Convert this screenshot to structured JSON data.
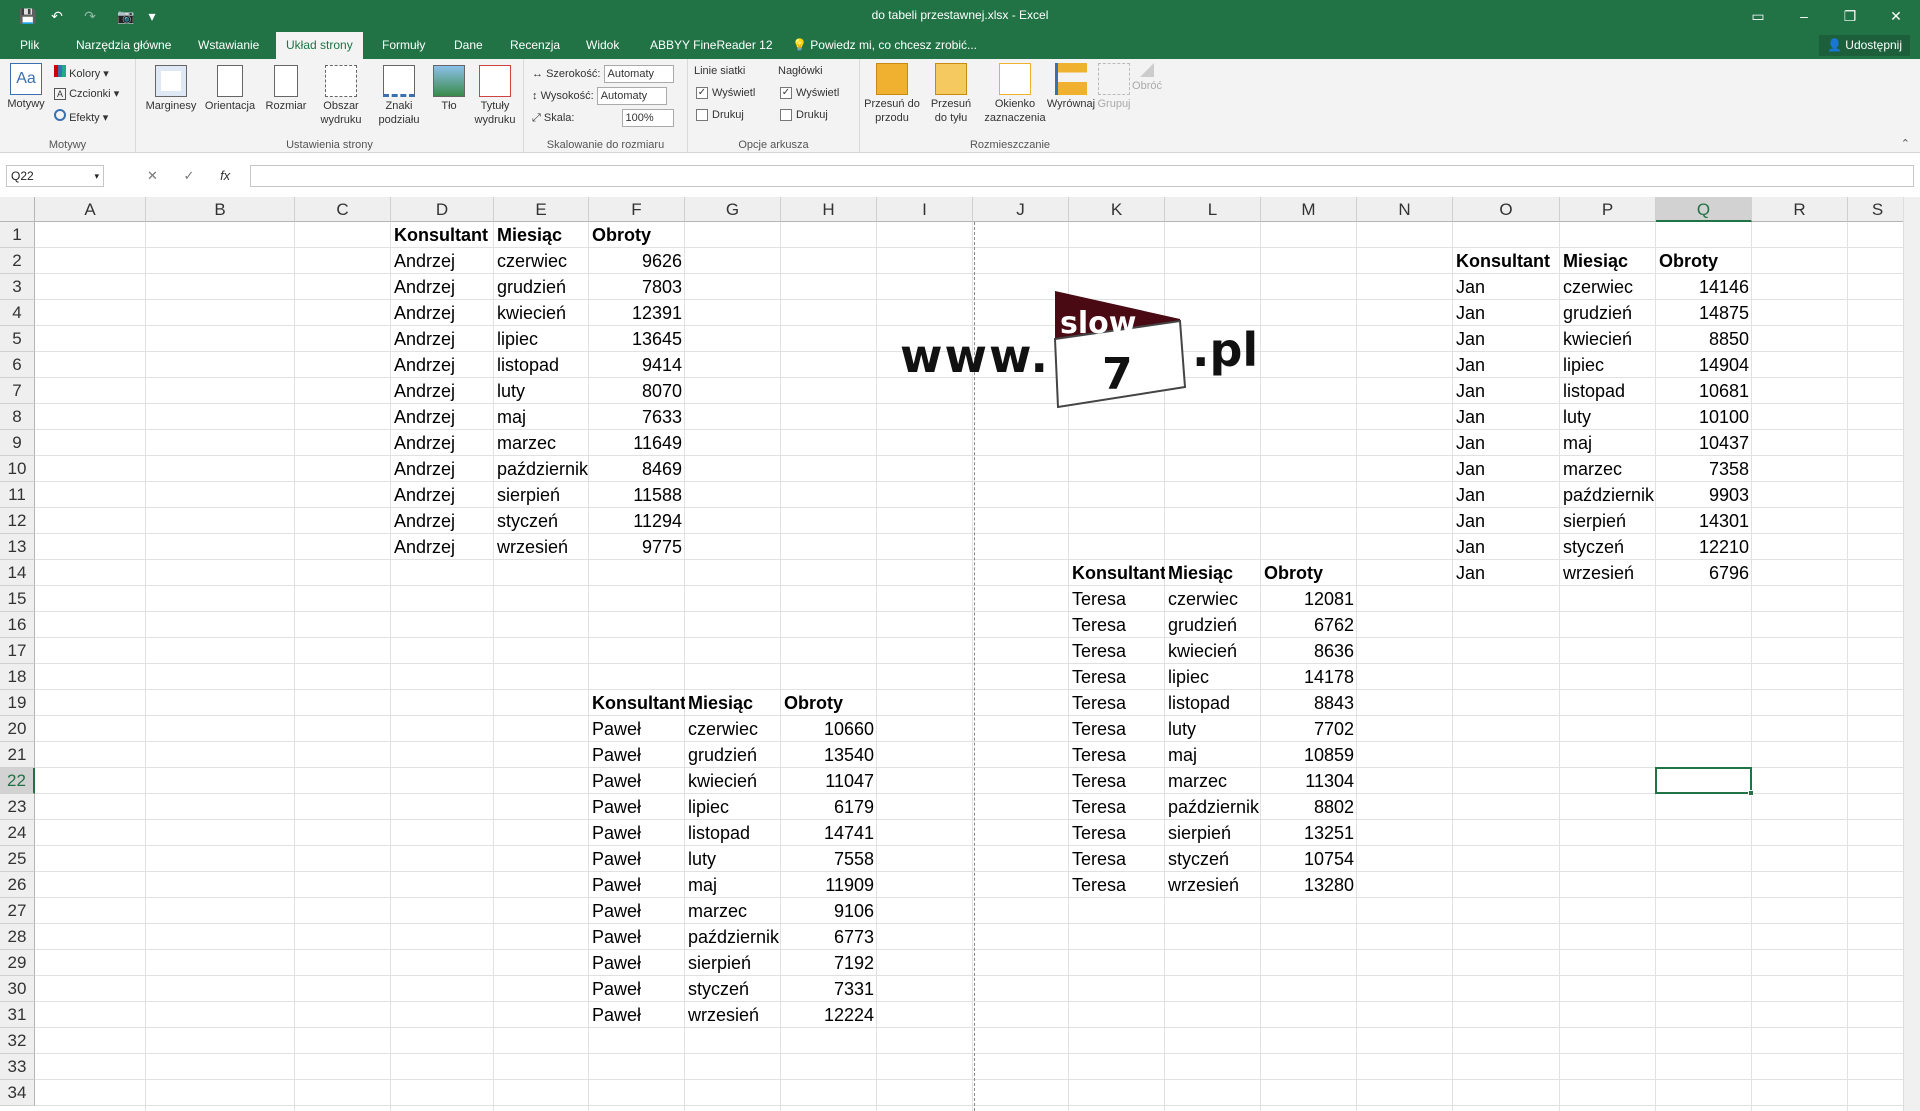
{
  "titlebar": {
    "title": "do tabeli przestawnej.xlsx - Excel"
  },
  "tabs": [
    "Plik",
    "Narzędzia główne",
    "Wstawianie",
    "Układ strony",
    "Formuły",
    "Dane",
    "Recenzja",
    "Widok",
    "ABBYY FineReader 12",
    "Powiedz mi, co chcesz zrobić..."
  ],
  "share_label": "Udostępnij",
  "ribbon": {
    "motywy": {
      "btn": "Motywy",
      "kolory": "Kolory",
      "czcionki": "Czcionki",
      "efekty": "Efekty",
      "label": "Motywy"
    },
    "ustawienia": {
      "marginesy": "Marginesy",
      "orientacja": "Orientacja",
      "rozmiar": "Rozmiar",
      "obszar1": "Obszar",
      "obszar2": "wydruku",
      "znaki1": "Znaki",
      "znaki2": "podziału",
      "tlo": "Tło",
      "tytuly1": "Tytuły",
      "tytuly2": "wydruku",
      "label": "Ustawienia strony"
    },
    "skalowanie": {
      "szerokosc": "Szerokość:",
      "wysokosc": "Wysokość:",
      "skala": "Skala:",
      "auto1": "Automaty",
      "auto2": "Automaty",
      "scale_value": "100%",
      "label": "Skalowanie do rozmiaru"
    },
    "opcje": {
      "linie": "Linie siatki",
      "naglowki": "Nagłówki",
      "wyswietl1": "Wyświetl",
      "drukuj1": "Drukuj",
      "wyswietl2": "Wyświetl",
      "drukuj2": "Drukuj",
      "label": "Opcje arkusza"
    },
    "rozmieszczanie": {
      "przesun_przod1": "Przesuń do",
      "przesun_przod2": "przodu",
      "przesun_tyl1": "Przesuń",
      "przesun_tyl2": "do tyłu",
      "okienko1": "Okienko",
      "okienko2": "zaznaczenia",
      "wyrownaj": "Wyrównaj",
      "grupuj": "Grupuj",
      "obroc": "Obróć",
      "label": "Rozmieszczanie"
    }
  },
  "formula_bar": {
    "name_box": "Q22",
    "fx": "fx",
    "value": ""
  },
  "columns": [
    "A",
    "B",
    "C",
    "D",
    "E",
    "F",
    "G",
    "H",
    "I",
    "J",
    "K",
    "L",
    "M",
    "N",
    "O",
    "P",
    "Q",
    "R",
    "S"
  ],
  "rows": [
    "1",
    "2",
    "3",
    "4",
    "5",
    "6",
    "7",
    "8",
    "9",
    "10",
    "11",
    "12",
    "13",
    "14",
    "15",
    "16",
    "17",
    "18",
    "19",
    "20",
    "21",
    "22",
    "23",
    "24",
    "25",
    "26",
    "27",
    "28",
    "29",
    "30",
    "31",
    "32",
    "33",
    "34"
  ],
  "headers": {
    "konsultant": "Konsultant",
    "miesiac": "Miesiąc",
    "obroty": "Obroty"
  },
  "tables": {
    "andrzej": {
      "name": "Andrzej",
      "months": [
        "czerwiec",
        "grudzień",
        "kwiecień",
        "lipiec",
        "listopad",
        "luty",
        "maj",
        "marzec",
        "październik",
        "sierpień",
        "styczeń",
        "wrzesień"
      ],
      "values": [
        "9626",
        "7803",
        "12391",
        "13645",
        "9414",
        "8070",
        "7633",
        "11649",
        "8469",
        "11588",
        "11294",
        "9775"
      ]
    },
    "jan": {
      "name": "Jan",
      "months": [
        "czerwiec",
        "grudzień",
        "kwiecień",
        "lipiec",
        "listopad",
        "luty",
        "maj",
        "marzec",
        "październik",
        "sierpień",
        "styczeń",
        "wrzesień"
      ],
      "values": [
        "14146",
        "14875",
        "8850",
        "14904",
        "10681",
        "10100",
        "10437",
        "7358",
        "9903",
        "14301",
        "12210",
        "6796"
      ]
    },
    "teresa": {
      "name": "Teresa",
      "months": [
        "czerwiec",
        "grudzień",
        "kwiecień",
        "lipiec",
        "listopad",
        "luty",
        "maj",
        "marzec",
        "październik",
        "sierpień",
        "styczeń",
        "wrzesień"
      ],
      "values": [
        "12081",
        "6762",
        "8636",
        "14178",
        "8843",
        "7702",
        "10859",
        "11304",
        "8802",
        "13251",
        "10754",
        "13280"
      ]
    },
    "pawel": {
      "name": "Paweł",
      "months": [
        "czerwiec",
        "grudzień",
        "kwiecień",
        "lipiec",
        "listopad",
        "luty",
        "maj",
        "marzec",
        "październik",
        "sierpień",
        "styczeń",
        "wrzesień"
      ],
      "values": [
        "10660",
        "13540",
        "11047",
        "6179",
        "14741",
        "7558",
        "11909",
        "9106",
        "6773",
        "7192",
        "7331",
        "12224"
      ]
    }
  },
  "logo": {
    "www": "www.",
    "slow": "slow",
    "seven": "7",
    "pl": ".pl"
  },
  "selected": {
    "col": "Q",
    "row": "22"
  }
}
